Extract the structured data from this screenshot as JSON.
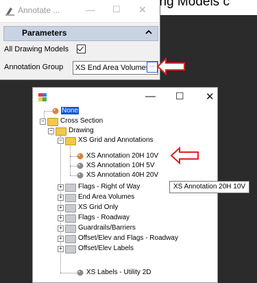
{
  "background_caption": "check the All Drawing Models c",
  "annotate_window": {
    "title": "Annotate ...",
    "min_glyph": "—",
    "max_glyph": "☐",
    "close_glyph": "✕",
    "section_title": "Parameters",
    "all_drawing_models_label": "All Drawing Models",
    "all_drawing_models_checked": true,
    "annotation_group_label": "Annotation Group",
    "annotation_group_value": "XS End Area Volumes",
    "browse_glyph": "..."
  },
  "tree_dialog": {
    "min_glyph": "—",
    "max_glyph": "☐",
    "close_glyph": "✕",
    "items": {
      "none": "None",
      "cross_section": "Cross Section",
      "drawing": "Drawing",
      "xs_grid_and_annotations": "XS Grid and Annotations",
      "xs_annotation_20h_10v": "XS Annotation 20H 10V",
      "xs_annotation_10h_5v": "XS Annotation 10H 5V",
      "xs_annotation_40h_20v": "XS Annotation 40H 20V",
      "flags_right_of_way": "Flags - Right of Way",
      "end_area_volumes": "End Area Volumes",
      "xs_grid_only": "XS Grid Only",
      "flags_roadway": "Flags - Roadway",
      "guardrails_barriers": "Guardrails/Barriers",
      "offset_elev_and_flags_roadway": "Offset/Elev and Flags - Roadway",
      "offset_elev_labels": "Offset/Elev Labels",
      "xs_labels_utility_2d": "XS Labels - Utility 2D"
    },
    "tooltip": "XS Annotation 20H 10V"
  },
  "accent_colors": {
    "selection": "#0a57d6",
    "highlight_arrow": "#e02020",
    "panel_header": "#c8d3e3"
  }
}
